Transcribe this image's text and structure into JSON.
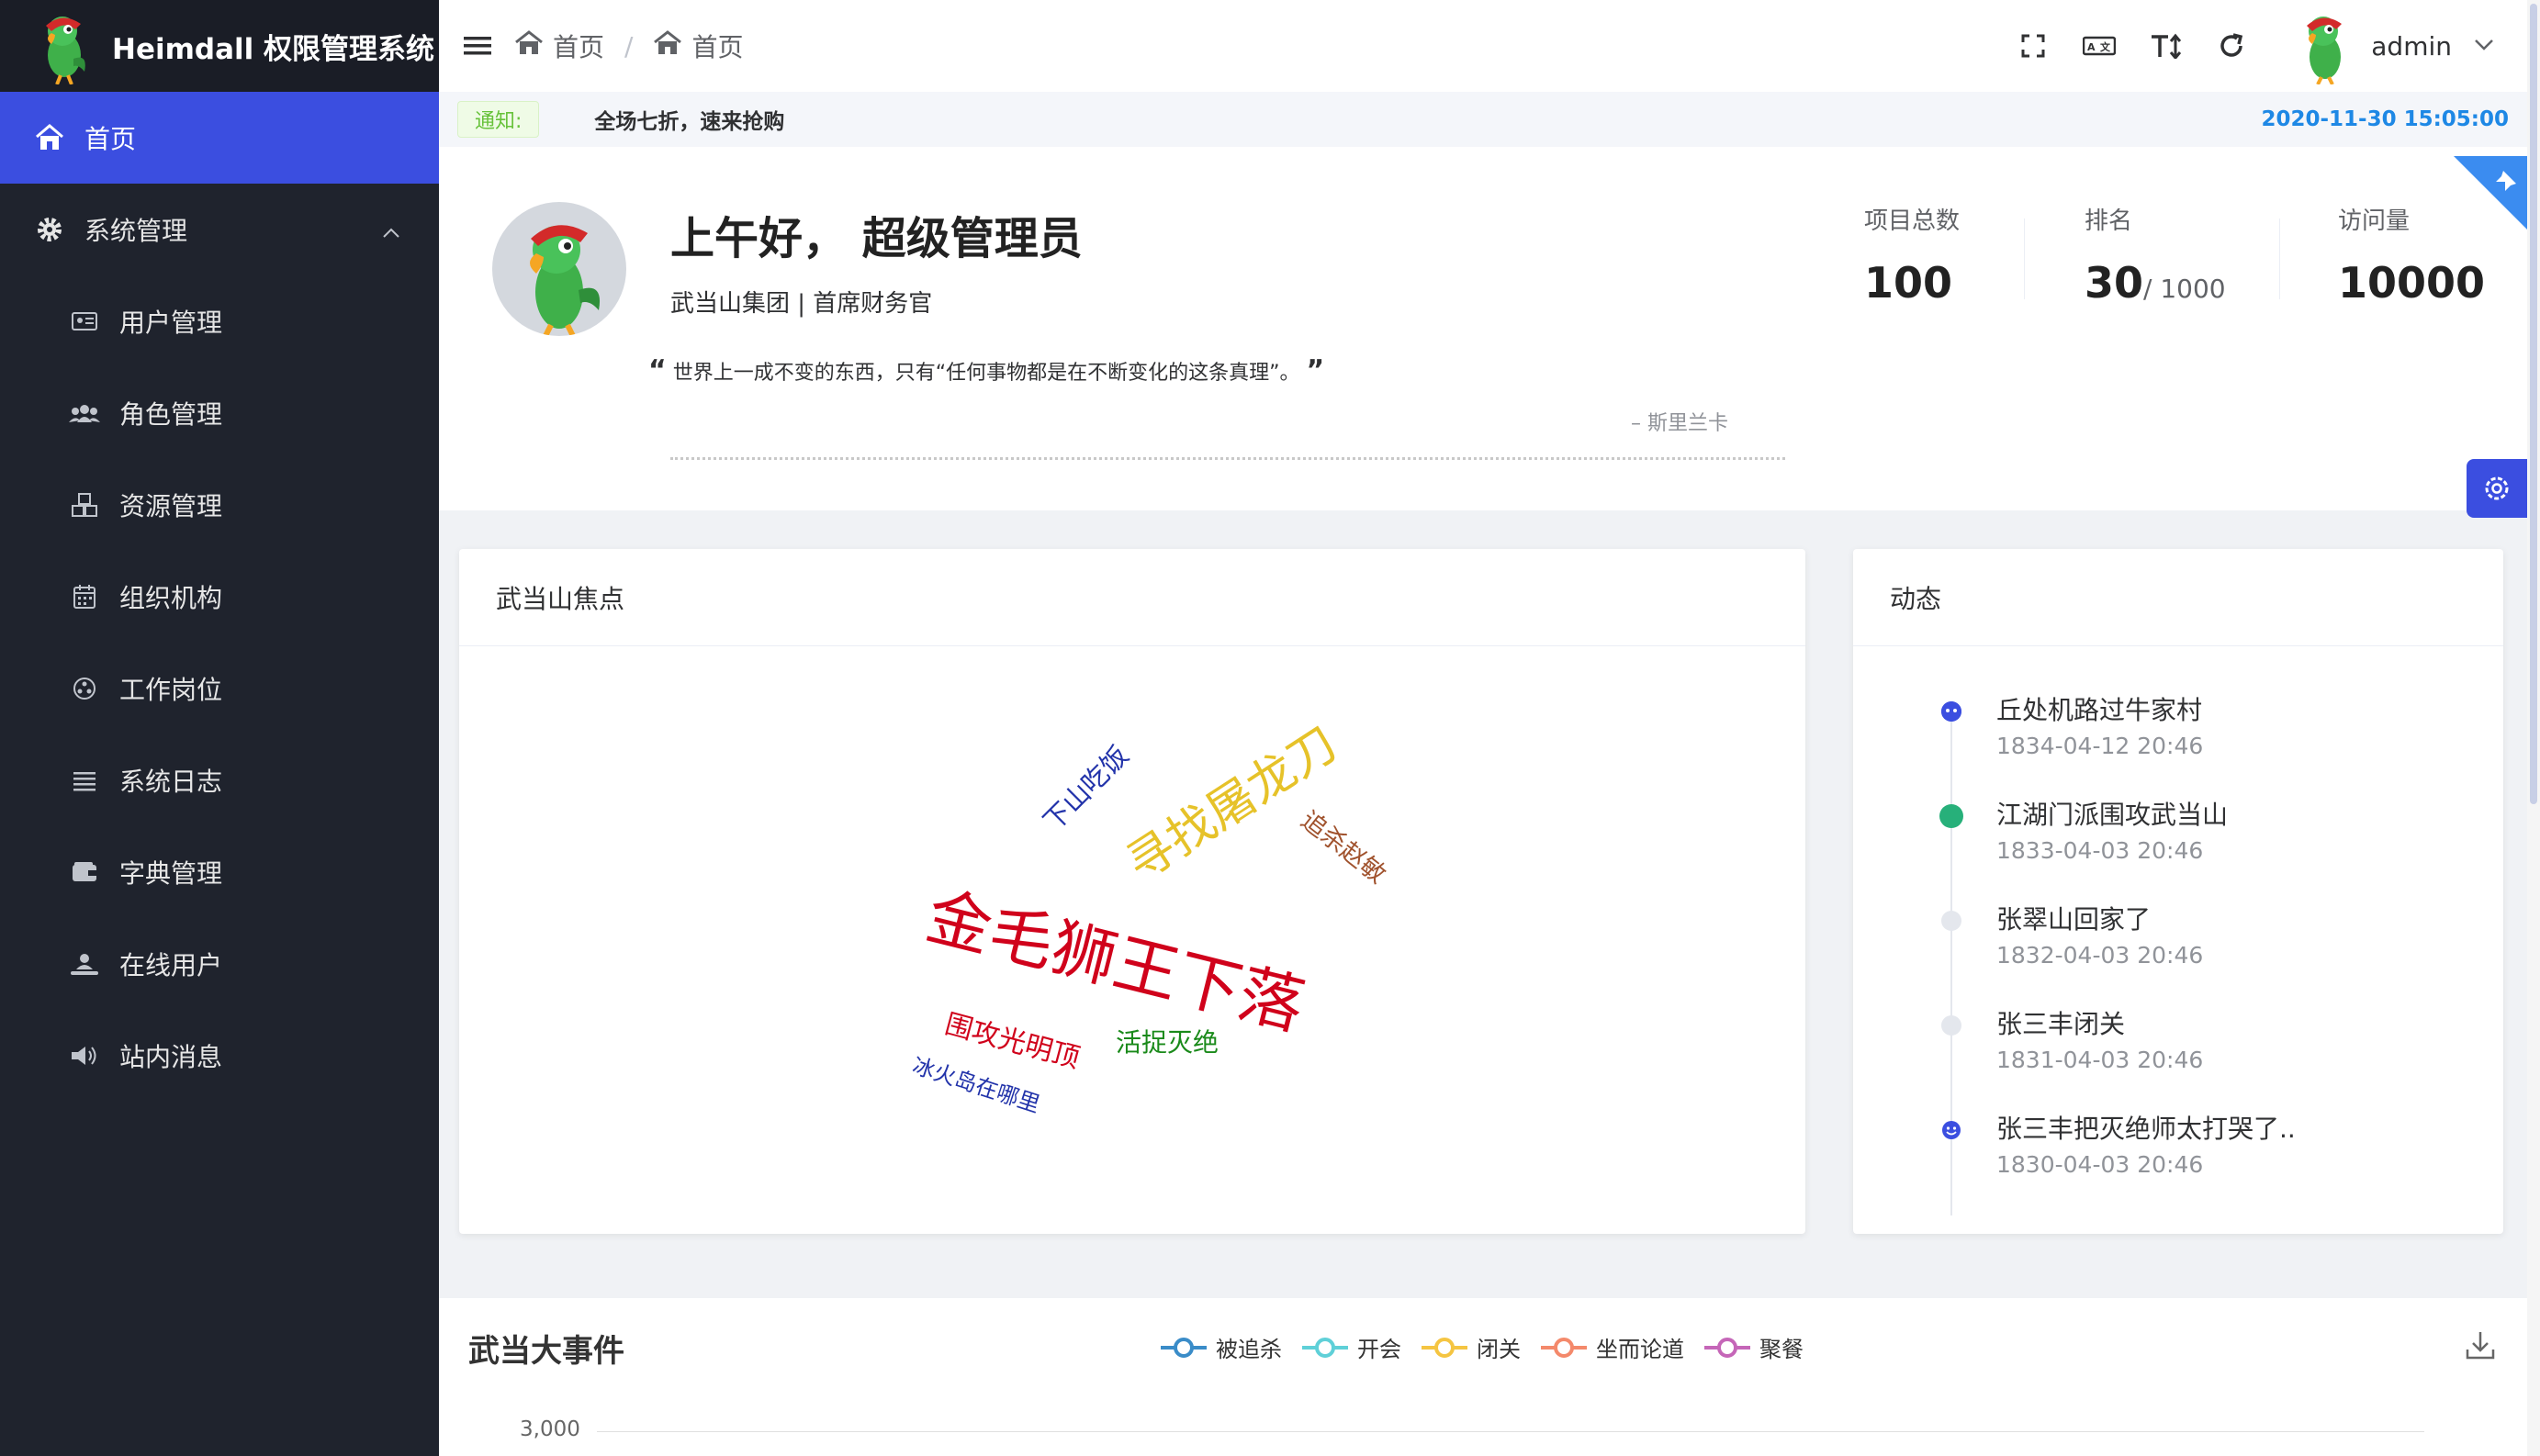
{
  "app": {
    "title": "Heimdall 权限管理系统"
  },
  "sidebar": {
    "items": [
      {
        "label": "首页",
        "icon": "home-icon",
        "active": true
      },
      {
        "label": "系统管理",
        "icon": "gear-icon",
        "expanded": true
      },
      {
        "label": "用户管理",
        "icon": "id-card-icon"
      },
      {
        "label": "角色管理",
        "icon": "users-icon"
      },
      {
        "label": "资源管理",
        "icon": "cubes-icon"
      },
      {
        "label": "组织机构",
        "icon": "calendar-icon"
      },
      {
        "label": "工作岗位",
        "icon": "dial-icon"
      },
      {
        "label": "系统日志",
        "icon": "list-icon"
      },
      {
        "label": "字典管理",
        "icon": "wallet-icon"
      },
      {
        "label": "在线用户",
        "icon": "online-user-icon"
      },
      {
        "label": "站内消息",
        "icon": "speaker-icon"
      }
    ]
  },
  "header": {
    "breadcrumb": [
      "首页",
      "首页"
    ],
    "username": "admin"
  },
  "notice": {
    "tag": "通知:",
    "text": "全场七折，速来抢购",
    "time": "2020-11-30 15:05:00"
  },
  "profile": {
    "greeting": "上午好， 超级管理员",
    "subtitle": "武当山集团 | 首席财务官",
    "quote": "世界上一成不变的东西，只有“任何事物都是在不断变化的这条真理”。",
    "quote_open": "“",
    "quote_close": "”",
    "author": "– 斯里兰卡",
    "stats": [
      {
        "label": "项目总数",
        "value": "100",
        "suffix": ""
      },
      {
        "label": "排名",
        "value": "30",
        "suffix": "/ 1000"
      },
      {
        "label": "访问量",
        "value": "10000",
        "suffix": ""
      }
    ]
  },
  "focus_card": {
    "title": "武当山焦点",
    "words": [
      {
        "text": "金毛狮王下落",
        "color": "#d0021b"
      },
      {
        "text": "寻找屠龙刀",
        "color": "#e6c229"
      },
      {
        "text": "下山吃饭",
        "color": "#2233aa"
      },
      {
        "text": "追杀赵敏",
        "color": "#a0522d"
      },
      {
        "text": "围攻光明顶",
        "color": "#d0021b"
      },
      {
        "text": "活捉灭绝",
        "color": "#1a8a1a"
      },
      {
        "text": "冰火岛在哪里",
        "color": "#2233aa"
      }
    ]
  },
  "activity_card": {
    "title": "动态",
    "items": [
      {
        "content": "丘处机路过牛家村",
        "time": "1834-04-12 20:46",
        "dot": "face-icon",
        "color": "#3b4ee0"
      },
      {
        "content": "江湖门派围攻武当山",
        "time": "1833-04-03 20:46",
        "dot": "solid",
        "color": "#27b07a"
      },
      {
        "content": "张翠山回家了",
        "time": "1832-04-03 20:46",
        "dot": "solid",
        "color": "#e4e7ed"
      },
      {
        "content": "张三丰闭关",
        "time": "1831-04-03 20:46",
        "dot": "solid",
        "color": "#e4e7ed"
      },
      {
        "content": "张三丰把灭绝师太打哭了..",
        "time": "1830-04-03 20:46",
        "dot": "smile-icon",
        "color": "#3b4ee0"
      }
    ]
  },
  "events_chart": {
    "title": "武当大事件",
    "legend": [
      {
        "name": "被追杀",
        "color": "#3a8cc8"
      },
      {
        "name": "开会",
        "color": "#5fd0d8"
      },
      {
        "name": "闭关",
        "color": "#f5c542"
      },
      {
        "name": "坐而论道",
        "color": "#f4896b"
      },
      {
        "name": "聚餐",
        "color": "#c566b8"
      }
    ],
    "y_tick": "3,000"
  },
  "chart_data": {
    "type": "line",
    "title": "武当大事件",
    "series": [
      {
        "name": "被追杀",
        "values": []
      },
      {
        "name": "开会",
        "values": []
      },
      {
        "name": "闭关",
        "values": []
      },
      {
        "name": "坐而论道",
        "values": []
      },
      {
        "name": "聚餐",
        "values": []
      }
    ],
    "y_ticks": [
      "3,000"
    ],
    "legend_position": "top-center"
  }
}
